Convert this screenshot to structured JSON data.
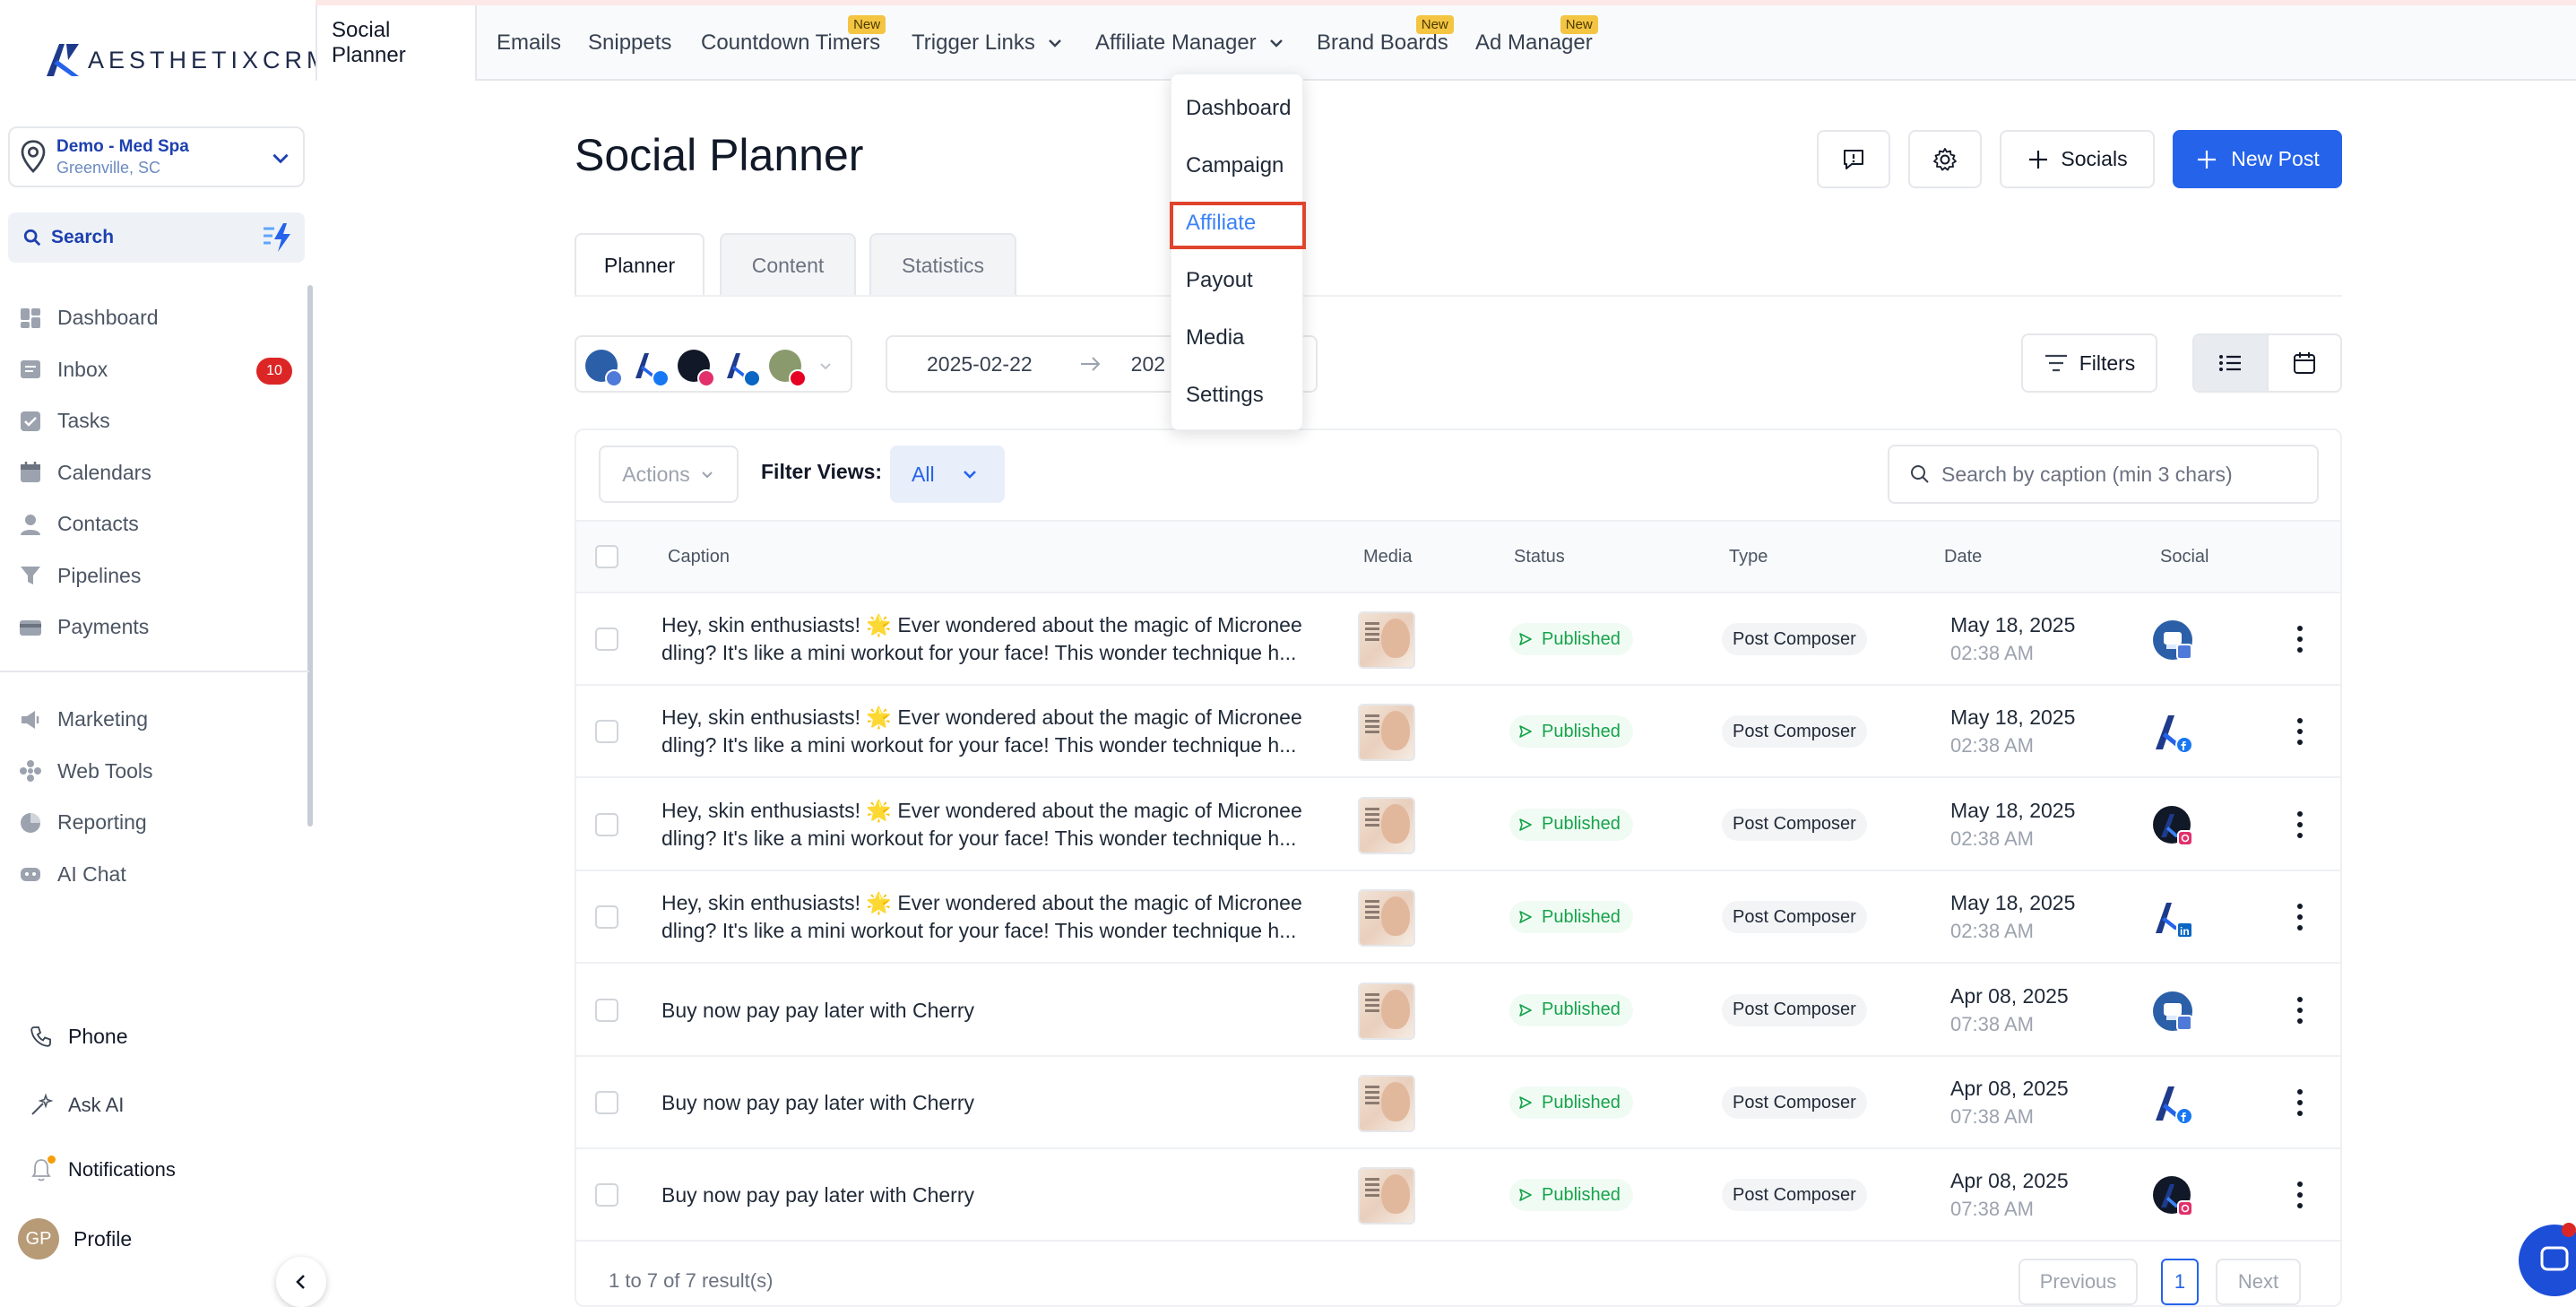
{
  "brand": {
    "name": "AESTHETIXCRM",
    "accent": "#2563eb"
  },
  "location": {
    "name": "Demo - Med Spa",
    "address": "Greenville, SC"
  },
  "sidebar": {
    "search_label": "Search",
    "items": [
      {
        "label": "Dashboard",
        "icon": "dashboard-icon"
      },
      {
        "label": "Inbox",
        "icon": "inbox-icon",
        "badge": "10"
      },
      {
        "label": "Tasks",
        "icon": "tasks-icon"
      },
      {
        "label": "Calendars",
        "icon": "calendar-icon"
      },
      {
        "label": "Contacts",
        "icon": "contacts-icon"
      },
      {
        "label": "Pipelines",
        "icon": "pipelines-icon"
      },
      {
        "label": "Payments",
        "icon": "payments-icon"
      }
    ],
    "items2": [
      {
        "label": "Marketing",
        "icon": "marketing-icon"
      },
      {
        "label": "Web Tools",
        "icon": "web-tools-icon"
      },
      {
        "label": "Reporting",
        "icon": "reporting-icon"
      },
      {
        "label": "AI Chat",
        "icon": "ai-chat-icon"
      }
    ],
    "bottom": {
      "phone": "Phone",
      "ask_ai": "Ask AI",
      "notifications": "Notifications",
      "profile": "Profile",
      "avatar_initials": "GP"
    }
  },
  "topnav": {
    "tabs": [
      {
        "label": "Social Planner",
        "active": true
      },
      {
        "label": "Emails"
      },
      {
        "label": "Snippets"
      },
      {
        "label": "Countdown Timers",
        "badge": "New"
      },
      {
        "label": "Trigger Links",
        "dropdown": true
      },
      {
        "label": "Affiliate Manager",
        "dropdown": true
      },
      {
        "label": "Brand Boards",
        "badge": "New"
      },
      {
        "label": "Ad Manager",
        "badge": "New"
      }
    ]
  },
  "affiliate_menu": {
    "items": [
      "Dashboard",
      "Campaign",
      "Affiliate",
      "Payout",
      "Media",
      "Settings"
    ],
    "highlighted": "Affiliate"
  },
  "page": {
    "title": "Social Planner",
    "socials_label": "Socials",
    "new_post_label": "New Post",
    "tabs": [
      "Planner",
      "Content",
      "Statistics"
    ],
    "active_tab": "Planner",
    "date_start": "2025-02-22",
    "date_end_partial": "202",
    "filters_label": "Filters",
    "view_mode": "list"
  },
  "toolbar": {
    "actions_label": "Actions",
    "filter_views_label": "Filter Views:",
    "filter_views_value": "All",
    "search_placeholder": "Search by caption (min 3 chars)"
  },
  "table": {
    "columns": [
      "Caption",
      "Media",
      "Status",
      "Type",
      "Date",
      "Social"
    ],
    "rows": [
      {
        "caption1": "Hey, skin enthusiasts! 🌟 Ever wondered about the magic of Micronee",
        "caption2": "dling? It's like a mini workout for your face! This wonder technique h...",
        "status": "Published",
        "type": "Post Composer",
        "date": "May 18, 2025",
        "time": "02:38 AM",
        "social": "gmb"
      },
      {
        "caption1": "Hey, skin enthusiasts! 🌟 Ever wondered about the magic of Micronee",
        "caption2": "dling? It's like a mini workout for your face! This wonder technique h...",
        "status": "Published",
        "type": "Post Composer",
        "date": "May 18, 2025",
        "time": "02:38 AM",
        "social": "facebook"
      },
      {
        "caption1": "Hey, skin enthusiasts! 🌟 Ever wondered about the magic of Micronee",
        "caption2": "dling? It's like a mini workout for your face! This wonder technique h...",
        "status": "Published",
        "type": "Post Composer",
        "date": "May 18, 2025",
        "time": "02:38 AM",
        "social": "instagram"
      },
      {
        "caption1": "Hey, skin enthusiasts! 🌟 Ever wondered about the magic of Micronee",
        "caption2": "dling? It's like a mini workout for your face! This wonder technique h...",
        "status": "Published",
        "type": "Post Composer",
        "date": "May 18, 2025",
        "time": "02:38 AM",
        "social": "linkedin"
      },
      {
        "caption1": "Buy now pay pay later with Cherry",
        "caption2": "",
        "status": "Published",
        "type": "Post Composer",
        "date": "Apr 08, 2025",
        "time": "07:38 AM",
        "social": "gmb"
      },
      {
        "caption1": "Buy now pay pay later with Cherry",
        "caption2": "",
        "status": "Published",
        "type": "Post Composer",
        "date": "Apr 08, 2025",
        "time": "07:38 AM",
        "social": "facebook"
      },
      {
        "caption1": "Buy now pay pay later with Cherry",
        "caption2": "",
        "status": "Published",
        "type": "Post Composer",
        "date": "Apr 08, 2025",
        "time": "07:38 AM",
        "social": "instagram"
      }
    ]
  },
  "pagination": {
    "count_text": "1 to 7 of 7 result(s)",
    "previous": "Previous",
    "page": "1",
    "next": "Next"
  }
}
